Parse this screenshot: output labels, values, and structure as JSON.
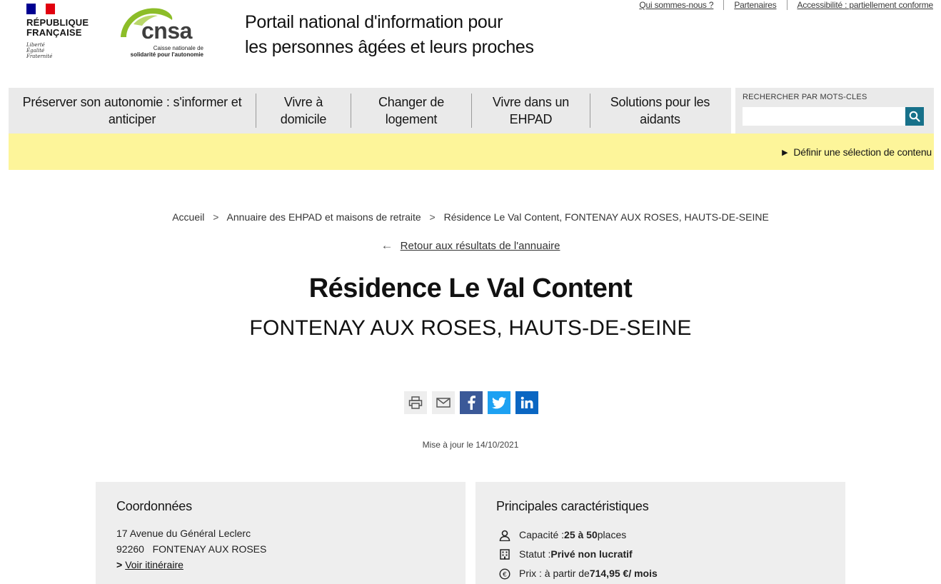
{
  "top_links": [
    "Qui sommes-nous ?",
    "Partenaires",
    "Accessibilité : partiellement conforme"
  ],
  "republique": {
    "name_line1": "RÉPUBLIQUE",
    "name_line2": "FRANÇAISE",
    "motto": [
      "Liberté",
      "Égalité",
      "Fraternité"
    ]
  },
  "cnsa": {
    "word": "cnsa",
    "sub_line1": "Caisse nationale de",
    "sub_line2": "solidarité pour l'autonomie",
    "accent_color": "#8cbd28"
  },
  "portal": {
    "title_line1": "Portail national d'information pour",
    "title_line2": "les personnes âgées et leurs proches"
  },
  "nav": {
    "items": [
      {
        "line1": "Préserver son autonomie : s'informer et",
        "line2": "anticiper"
      },
      {
        "line1": "Vivre à",
        "line2": "domicile"
      },
      {
        "line1": "Changer de",
        "line2": "logement"
      },
      {
        "line1": "Vivre dans un",
        "line2": "EHPAD"
      },
      {
        "line1": "Solutions pour les",
        "line2": "aidants"
      }
    ]
  },
  "search": {
    "label": "RECHERCHER PAR MOTS-CLES",
    "value": "",
    "button_color": "#17718a"
  },
  "selection": {
    "label": "Définir une sélection de contenu",
    "bar_color": "#fdf59a"
  },
  "breadcrumb": {
    "items": [
      "Accueil",
      "Annuaire des EHPAD et maisons de retraite",
      "Résidence Le Val Content, FONTENAY AUX ROSES, HAUTS-DE-SEINE"
    ]
  },
  "back_link": "Retour aux résultats de l'annuaire",
  "page": {
    "title": "Résidence Le Val Content",
    "subtitle": "FONTENAY AUX ROSES, HAUTS-DE-SEINE",
    "updated": "Mise à jour le 14/10/2021"
  },
  "share": {
    "icons": [
      "print-icon",
      "mail-icon",
      "facebook-icon",
      "twitter-icon",
      "linkedin-icon"
    ]
  },
  "contact": {
    "title": "Coordonnées",
    "address_line1": "17 Avenue du Général Leclerc",
    "postal_code": "92260",
    "city": "FONTENAY AUX ROSES",
    "itinerary_label": "Voir itinéraire"
  },
  "features": {
    "title": "Principales caractéristiques",
    "capacity_label": "Capacité : ",
    "capacity_value": "25 à 50",
    "capacity_unit": " places",
    "status_label": "Statut : ",
    "status_value": "Privé non lucratif",
    "price_label": "Prix : à partir de ",
    "price_value": "714,95 €/ mois"
  }
}
